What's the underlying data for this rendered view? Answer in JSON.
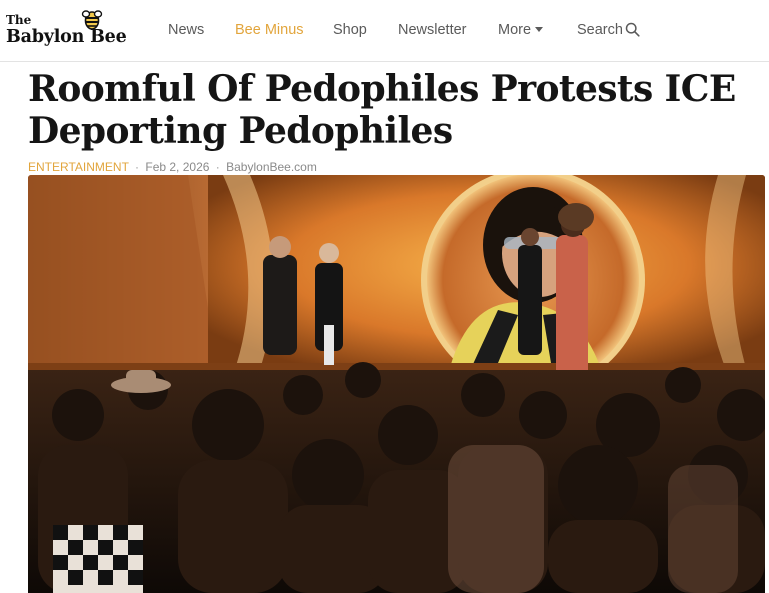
{
  "site": {
    "logo_top": "The",
    "logo_name": "Babylon Bee"
  },
  "nav": {
    "items": [
      {
        "label": "News",
        "active": false
      },
      {
        "label": "Bee Minus",
        "active": true
      },
      {
        "label": "Shop",
        "active": false
      },
      {
        "label": "Newsletter",
        "active": false
      },
      {
        "label": "More",
        "active": false
      },
      {
        "label": "Search",
        "active": false
      }
    ]
  },
  "article": {
    "headline": "Roomful Of Pedophiles Protests ICE Deporting Pedophiles",
    "category": "ENTERTAINMENT",
    "separator": "·",
    "date": "Feb 2, 2026",
    "source": "BabylonBee.com"
  },
  "colors": {
    "accent": "#e2a53c",
    "nav_text": "#5a5a5a",
    "headline": "#151515",
    "meta": "#8a8a8a"
  },
  "icons": {
    "logo": "bee-icon",
    "more": "chevron-down-icon",
    "search": "search-icon"
  }
}
